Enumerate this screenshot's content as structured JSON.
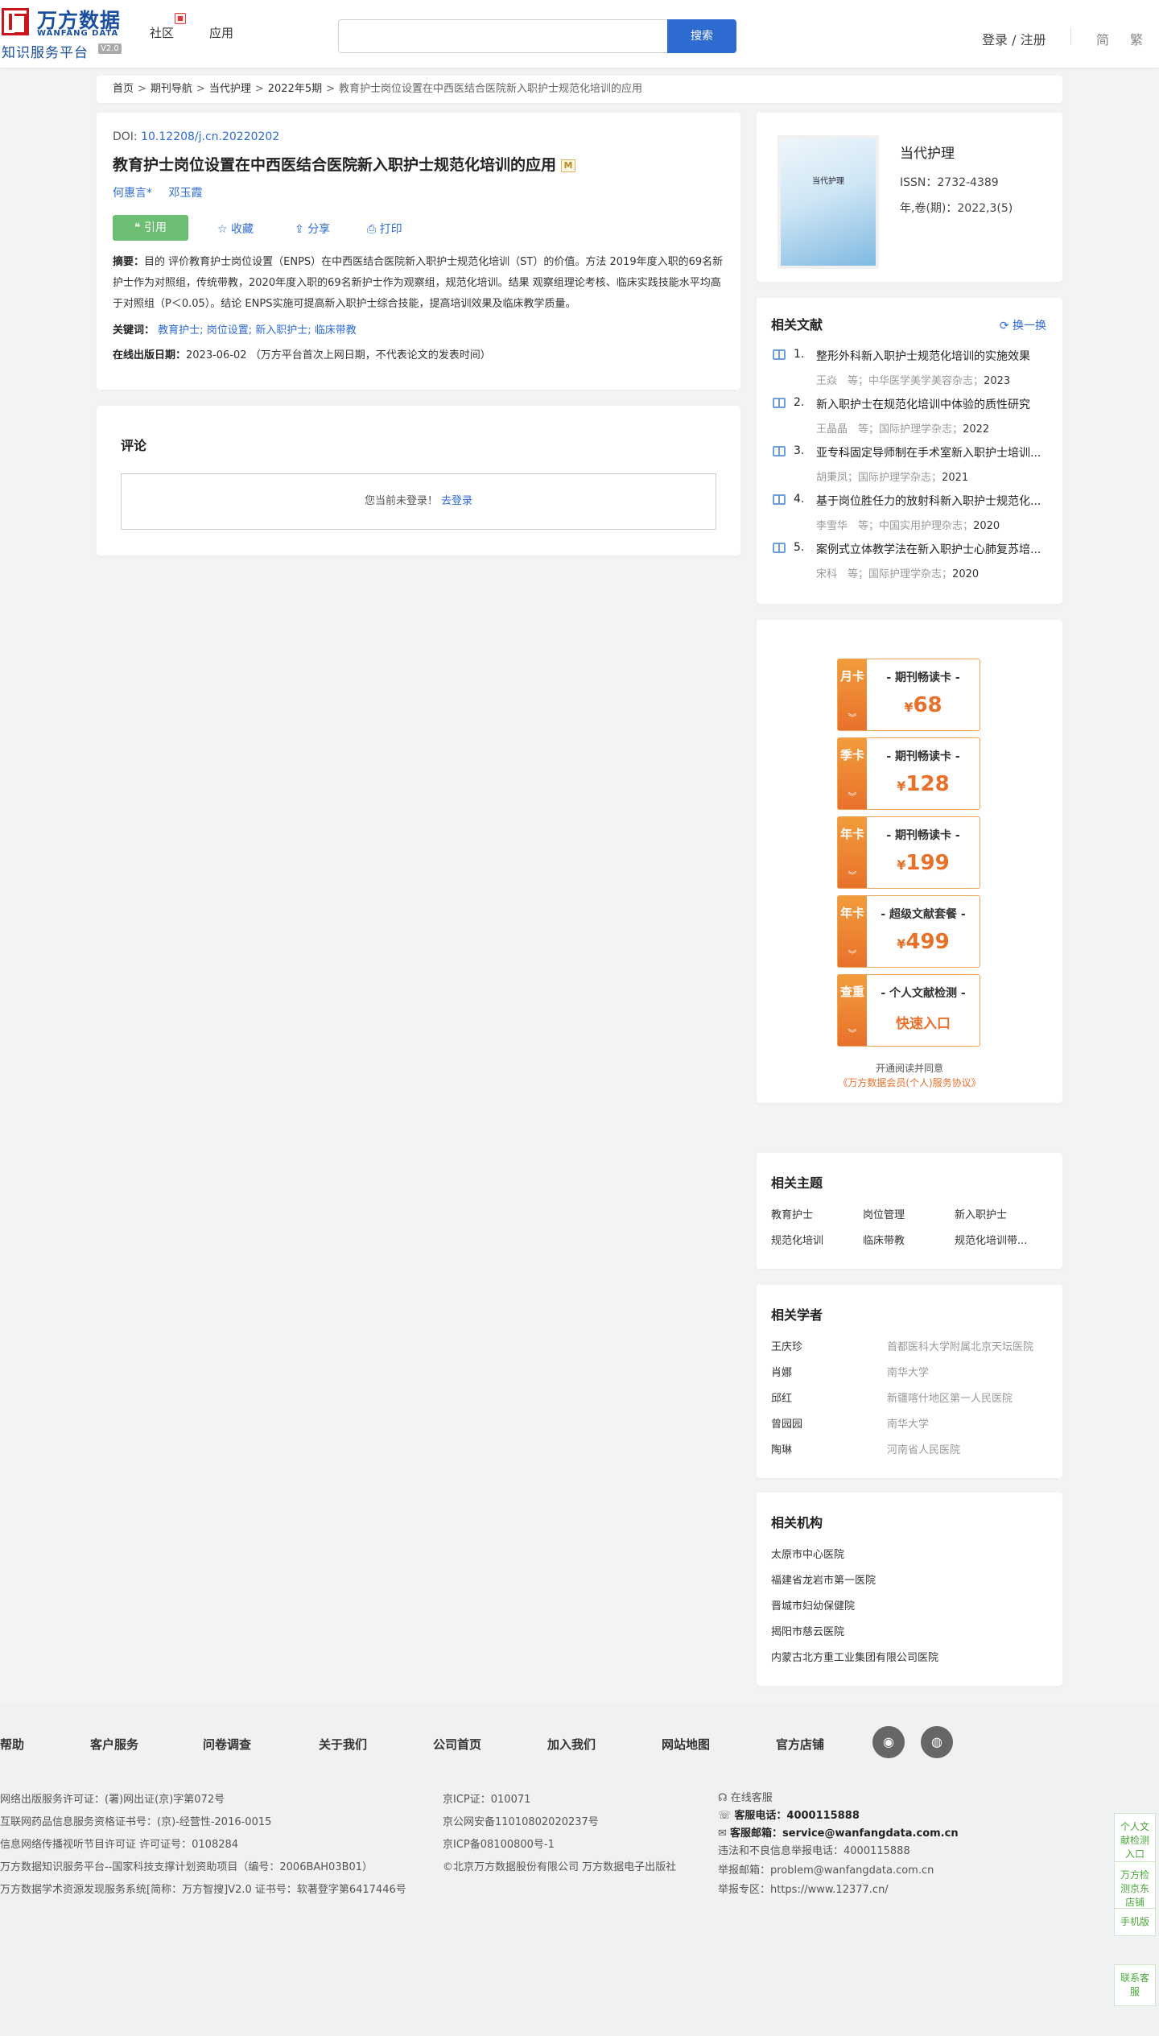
{
  "header": {
    "logo_cn": "万方数据",
    "logo_en": "WANFANG DATA",
    "logo_sub": "知识服务平台",
    "logo_version": "V2.0",
    "nav": [
      "社区",
      "应用"
    ],
    "search_placeholder": "",
    "search_button": "搜索",
    "login": "登录 / 注册",
    "lang_simplified": "简",
    "lang_traditional": "繁"
  },
  "breadcrumb": {
    "items": [
      "首页",
      "期刊导航",
      "当代护理",
      "2022年5期"
    ],
    "separator": ">",
    "current": "教育护士岗位设置在中西医结合医院新入职护士规范化培训的应用"
  },
  "article": {
    "doi_label": "DOI:",
    "doi_value": "10.12208/j.cn.20220202",
    "title": "教育护士岗位设置在中西医结合医院新入职护士规范化培训的应用",
    "badge": "M",
    "authors": [
      "何惠言*",
      "邓玉霞"
    ],
    "actions": {
      "cite": "❝ 引用",
      "favorite": "收藏",
      "share": "分享",
      "print": "打印"
    },
    "abstract_label": "摘要：",
    "abstract": "目的 评价教育护士岗位设置（ENPS）在中西医结合医院新入职护士规范化培训（ST）的价值。方法 2019年度入职的69名新护士作为对照组，传统带教，2020年度入职的69名新护士作为观察组，规范化培训。结果 观察组理论考核、临床实践技能水平均高于对照组（P＜0.05）。结论 ENPS实施可提高新入职护士综合技能，提高培训效果及临床教学质量。",
    "keywords_label": "关键词：",
    "keywords": [
      "教育护士;",
      "岗位设置;",
      "新入职护士;",
      "临床带教"
    ],
    "pubdate_label": "在线出版日期：",
    "pubdate": "2023-06-02",
    "pubdate_note": "（万方平台首次上网日期，不代表论文的发表时间）"
  },
  "comment": {
    "title": "评论",
    "not_logged_in": "您当前未登录！",
    "login_link": "去登录"
  },
  "journal": {
    "cover_text": "当代护理",
    "name": "当代护理",
    "issn": "ISSN：2732-4389",
    "year_vol": "年,卷(期)：2022,3(5)"
  },
  "related_docs": {
    "title": "相关文献",
    "swap": "换一换",
    "items": [
      {
        "num": "1.",
        "title": "整形外科新入职护士规范化培训的实施效果",
        "authors": "王焱　等",
        "journal": "中华医学美学美容杂志",
        "year": "2023"
      },
      {
        "num": "2.",
        "title": "新入职护士在规范化培训中体验的质性研究",
        "authors": "王晶晶　等",
        "journal": "国际护理学杂志",
        "year": "2022"
      },
      {
        "num": "3.",
        "title": "亚专科固定导师制在手术室新入职护士培训...",
        "authors": "胡秉凤",
        "journal": "国际护理学杂志",
        "year": "2021"
      },
      {
        "num": "4.",
        "title": "基于岗位胜任力的放射科新入职护士规范化...",
        "authors": "李雪华　等",
        "journal": "中国实用护理杂志",
        "year": "2020"
      },
      {
        "num": "5.",
        "title": "案例式立体教学法在新入职护士心肺复苏培...",
        "authors": "宋科　等",
        "journal": "国际护理学杂志",
        "year": "2020"
      }
    ]
  },
  "cards": {
    "items": [
      {
        "side": "月卡",
        "title": "- 期刊畅读卡 -",
        "currency": "¥",
        "price": "68"
      },
      {
        "side": "季卡",
        "title": "- 期刊畅读卡 -",
        "currency": "¥",
        "price": "128"
      },
      {
        "side": "年卡",
        "title": "- 期刊畅读卡 -",
        "currency": "¥",
        "price": "199"
      },
      {
        "side": "年卡",
        "title": "- 超级文献套餐 -",
        "currency": "¥",
        "price": "499"
      },
      {
        "side": "查重",
        "title": "- 个人文献检测 -",
        "quick": "快速入口"
      }
    ],
    "note": "开通阅读并同意",
    "agreement": "《万方数据会员(个人)服务协议》"
  },
  "topics": {
    "title": "相关主题",
    "items": [
      "教育护士",
      "岗位管理",
      "新入职护士",
      "规范化培训",
      "临床带教",
      "规范化培训带..."
    ]
  },
  "scholars": {
    "title": "相关学者",
    "items": [
      {
        "name": "王庆珍",
        "org": "首都医科大学附属北京天坛医院"
      },
      {
        "name": "肖娜",
        "org": "南华大学"
      },
      {
        "name": "邱红",
        "org": "新疆喀什地区第一人民医院"
      },
      {
        "name": "曾园园",
        "org": "南华大学"
      },
      {
        "name": "陶琳",
        "org": "河南省人民医院"
      }
    ]
  },
  "orgs": {
    "title": "相关机构",
    "items": [
      "太原市中心医院",
      "福建省龙岩市第一医院",
      "晋城市妇幼保健院",
      "揭阳市慈云医院",
      "内蒙古北方重工业集团有限公司医院"
    ]
  },
  "footer": {
    "nav": [
      "帮助",
      "客户服务",
      "问卷调查",
      "关于我们",
      "公司首页",
      "加入我们",
      "网站地图",
      "官方店铺"
    ],
    "col1": [
      "网络出版服务许可证：(署)网出证(京)字第072号",
      "互联网药品信息服务资格证书号：(京)-经营性-2016-0015",
      "信息网络传播视听节目许可证 许可证号：0108284",
      "万方数据知识服务平台--国家科技支撑计划资助项目（编号：2006BAH03B01）",
      "万方数据学术资源发现服务系统[简称：万方智搜]V2.0 证书号：软著登字第6417446号"
    ],
    "col2": [
      "京ICP证：010071",
      "京公网安备11010802020237号",
      "京ICP备08100800号-1",
      "©北京万方数据股份有限公司 万方数据电子出版社"
    ],
    "service_title": "在线客服",
    "phone_label": "客服电话：",
    "phone": "4000115888",
    "email_label": "客服邮箱：",
    "email": "service@wanfangdata.com.cn",
    "report_phone": "违法和不良信息举报电话：4000115888",
    "report_email": "举报邮箱：problem@wanfangdata.com.cn",
    "report_zone": "举报专区：https://www.12377.cn/"
  },
  "side_tools": [
    "个人文献检测入口",
    "万方检测京东店铺",
    "手机版",
    "联系客服"
  ]
}
